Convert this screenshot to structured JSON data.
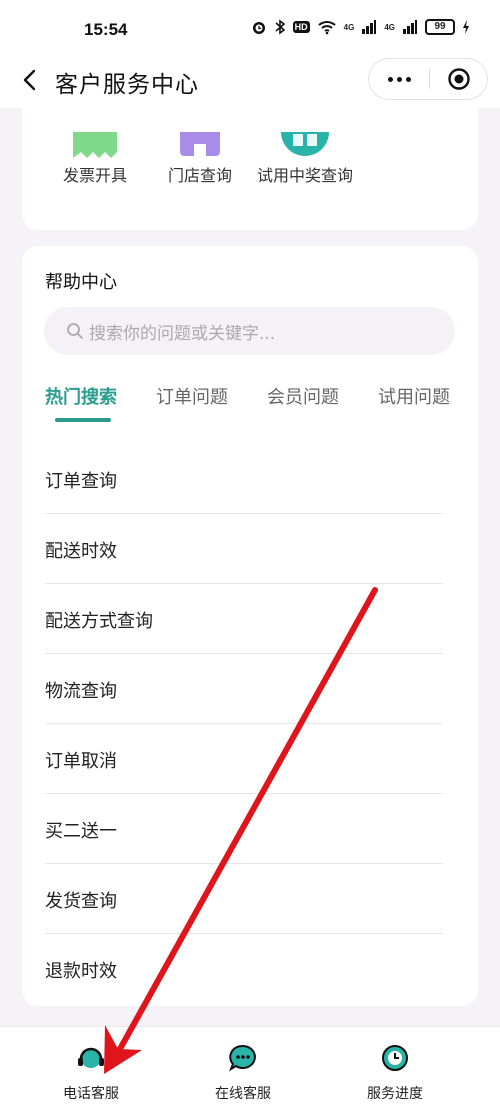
{
  "status_bar": {
    "time": "15:54",
    "battery": "99",
    "hd": "HD",
    "net1": "4G",
    "net2": "4G"
  },
  "nav": {
    "title": "客户服务中心",
    "back_icon": "chevron-left-icon",
    "more_icon": "more-dots-icon",
    "close_icon": "target-close-icon"
  },
  "services": [
    {
      "label": "发票开具",
      "color": "#7fd98b",
      "icon": "invoice-icon"
    },
    {
      "label": "门店查询",
      "color": "#a98be8",
      "icon": "store-icon"
    },
    {
      "label": "试用中奖查询",
      "color": "#2ab3a8",
      "icon": "trial-prize-icon"
    }
  ],
  "help": {
    "title": "帮助中心",
    "search_placeholder": "搜索你的问题或关键字...",
    "tabs": [
      "热门搜索",
      "订单问题",
      "会员问题",
      "试用问题"
    ],
    "active_tab": "热门搜索",
    "items": [
      "订单查询",
      "配送时效",
      "配送方式查询",
      "物流查询",
      "订单取消",
      "买二送一",
      "发货查询",
      "退款时效"
    ]
  },
  "bottom_bar": [
    {
      "label": "电话客服",
      "icon": "headset-icon"
    },
    {
      "label": "在线客服",
      "icon": "chat-bubble-icon"
    },
    {
      "label": "服务进度",
      "icon": "clock-icon"
    }
  ],
  "colors": {
    "accent": "#2a9d8f",
    "annotation_arrow": "#e0141b"
  }
}
